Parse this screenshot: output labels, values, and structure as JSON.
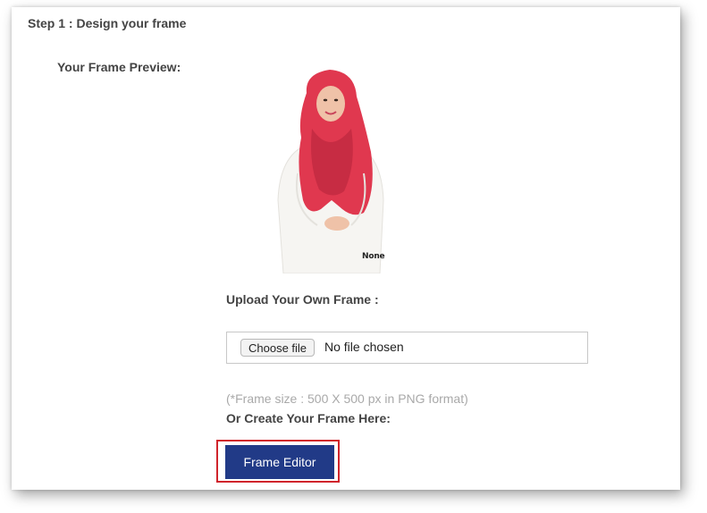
{
  "step": {
    "title": "Step 1 : Design your frame"
  },
  "preview": {
    "label": "Your Frame Preview:",
    "caption": "None",
    "colors": {
      "hijab": "#e0384f",
      "top": "#f6f5f2",
      "skin": "#efc2a8"
    }
  },
  "upload": {
    "label": "Upload Your Own Frame :",
    "choose_button": "Choose file",
    "file_status": "No file chosen",
    "hint": "(*Frame size : 500 X 500 px in PNG format)"
  },
  "create": {
    "label": "Or Create Your Frame Here:",
    "editor_button": "Frame Editor"
  },
  "colors": {
    "button_bg": "#213a87",
    "highlight_border": "#d0242b",
    "text": "#444444",
    "hint_text": "#a9a9a9"
  }
}
